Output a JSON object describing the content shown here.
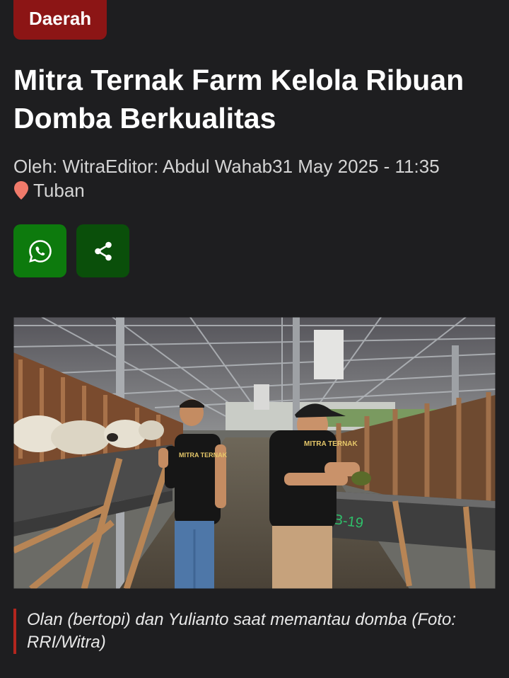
{
  "category": "Daerah",
  "article": {
    "title": "Mitra Ternak Farm Kelola Ribuan Domba Berkualitas",
    "author_label": "Oleh: ",
    "author": "Witra",
    "editor_label": "Editor: ",
    "editor": "Abdul Wahab",
    "date": "31 May 2025 - 11:35",
    "location": "Tuban"
  },
  "share": {
    "whatsapp_icon": "whatsapp-icon",
    "share_icon": "share-icon"
  },
  "photo": {
    "shirt_text": "MITRA TERNAK",
    "trough_text": "B-19"
  },
  "caption": "Olan (bertopi) dan Yulianto saat memantau domba (Foto: RRI/Witra)",
  "colors": {
    "background": "#1e1e20",
    "badge": "#8c1515",
    "whatsapp_button": "#0d7a0d",
    "share_button": "#0a4f0a",
    "pin": "#f07a6a",
    "caption_bar": "#b3261e"
  }
}
